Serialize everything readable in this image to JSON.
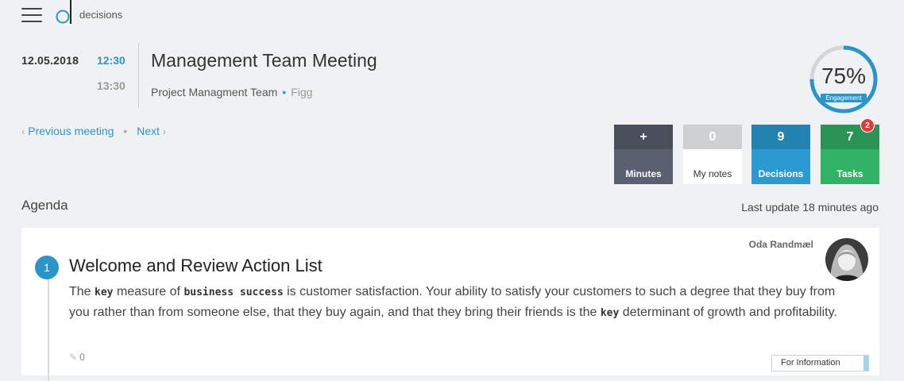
{
  "app": {
    "logo_text": "decisions",
    "accent_color": "#2b95c9"
  },
  "meeting": {
    "date": "12.05.2018",
    "time_start": "12:30",
    "time_end": "13:30",
    "title": "Management Team Meeting",
    "team": "Project Managment Team",
    "location": "Figg"
  },
  "nav": {
    "previous_label": "Previous meeting",
    "next_label": "Next"
  },
  "engagement": {
    "value": "75%",
    "fraction": 0.75,
    "label": "Engagement"
  },
  "tiles": {
    "minutes": {
      "value": "+",
      "label": "Minutes"
    },
    "notes": {
      "value": "0",
      "label": "My notes"
    },
    "decisions": {
      "value": "9",
      "label": "Decisions"
    },
    "tasks": {
      "value": "7",
      "label": "Tasks",
      "badge": "2"
    }
  },
  "agenda": {
    "title": "Agenda",
    "last_update": "Last update 18 minutes ago",
    "items": [
      {
        "number": "1",
        "title": "Welcome and Review Action List",
        "author": "Oda Randmæl",
        "body": {
          "t1": "The ",
          "k1": "key",
          "t2": " measure of ",
          "k2": "business success",
          "t3": " is customer satisfaction. Your ability to satisfy your customers to such a degree that they buy from you rather than from someone else, that they buy again, and that they bring their friends is the ",
          "k3": "key",
          "t4": " determinant of growth and profitability."
        },
        "edits": "0",
        "tag": "For Information"
      }
    ]
  }
}
